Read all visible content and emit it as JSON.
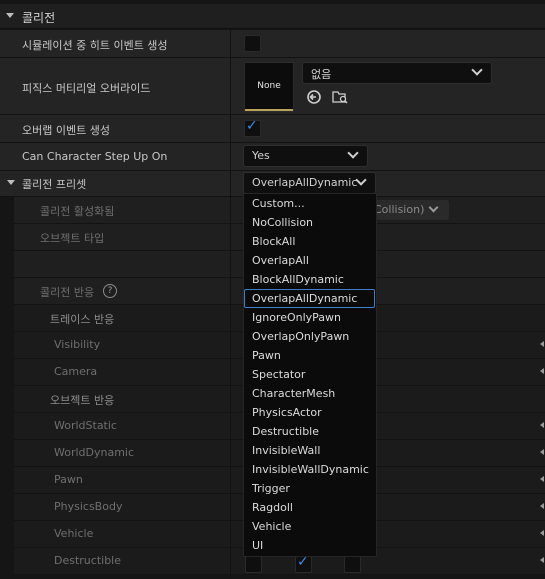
{
  "section": {
    "title": "콜리전"
  },
  "props": {
    "sim_hit": {
      "label": "시뮬레이션 중 히트 이벤트 생성",
      "checked": false
    },
    "phys_mat": {
      "label": "피직스 머티리얼 오버라이드",
      "thumb": "None",
      "value": "없음"
    },
    "overlap": {
      "label": "오버랩 이벤트 생성",
      "checked": true
    },
    "step_up": {
      "label": "Can Character Step Up On",
      "value": "Yes"
    },
    "preset": {
      "label": "콜리전 프리셋",
      "value": "OverlapAllDynamic"
    }
  },
  "sub": {
    "enabled": "콜리전 활성화됨",
    "enabled_value": "Collision)",
    "object_type": "오브젝트 타입",
    "responses": "콜리전 반응",
    "trace": "트레이스 반응",
    "visibility": "Visibility",
    "camera": "Camera",
    "obj_resp": "오브젝트 반응",
    "worldstatic": "WorldStatic",
    "worlddynamic": "WorldDynamic",
    "pawn": "Pawn",
    "physicsbody": "PhysicsBody",
    "vehicle": "Vehicle",
    "destructible": "Destructible"
  },
  "dropdown": {
    "selected": "OverlapAllDynamic",
    "options": [
      "Custom...",
      "NoCollision",
      "BlockAll",
      "OverlapAll",
      "BlockAllDynamic",
      "OverlapAllDynamic",
      "IgnoreOnlyPawn",
      "OverlapOnlyPawn",
      "Pawn",
      "Spectator",
      "CharacterMesh",
      "PhysicsActor",
      "Destructible",
      "InvisibleWall",
      "InvisibleWallDynamic",
      "Trigger",
      "Ragdoll",
      "Vehicle",
      "UI"
    ]
  },
  "icons": {
    "reset": "reset-arrow-icon",
    "browse": "browse-folder-icon",
    "help": "help-icon"
  },
  "colors": {
    "accent": "#3b8ee6",
    "selection": "#3f7fc4",
    "thumb_bar": "#b8a35a"
  }
}
